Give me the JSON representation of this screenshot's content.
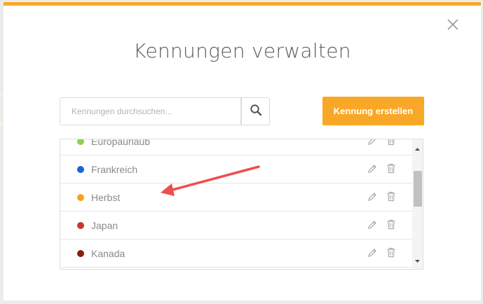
{
  "modal": {
    "title": "Kennungen verwalten",
    "accent_color": "#f8a826"
  },
  "search": {
    "placeholder": "Kennungen durchsuchen...",
    "value": ""
  },
  "create_button": {
    "label": "Kennung erstellen"
  },
  "tags": [
    {
      "label": "Europaurlaub",
      "color": "#8cd24a"
    },
    {
      "label": "Frankreich",
      "color": "#1b63d6"
    },
    {
      "label": "Herbst",
      "color": "#f2a41c"
    },
    {
      "label": "Japan",
      "color": "#c8382e"
    },
    {
      "label": "Kanada",
      "color": "#8b1e12"
    }
  ],
  "icons": {
    "close": "close-icon",
    "search": "search-icon",
    "edit": "pencil-icon",
    "delete": "trash-icon"
  },
  "annotation": {
    "color": "#f04d4d"
  }
}
